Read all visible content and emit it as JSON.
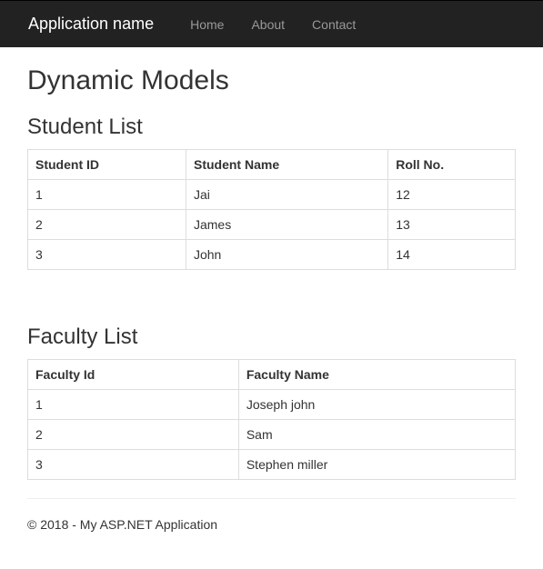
{
  "navbar": {
    "brand": "Application name",
    "links": [
      {
        "label": "Home"
      },
      {
        "label": "About"
      },
      {
        "label": "Contact"
      }
    ]
  },
  "page": {
    "title": "Dynamic Models"
  },
  "studentSection": {
    "heading": "Student List",
    "headers": {
      "id": "Student ID",
      "name": "Student Name",
      "roll": "Roll No."
    },
    "rows": [
      {
        "id": "1",
        "name": "Jai",
        "roll": "12"
      },
      {
        "id": "2",
        "name": "James",
        "roll": "13"
      },
      {
        "id": "3",
        "name": "John",
        "roll": "14"
      }
    ]
  },
  "facultySection": {
    "heading": "Faculty List",
    "headers": {
      "id": "Faculty Id",
      "name": "Faculty Name"
    },
    "rows": [
      {
        "id": "1",
        "name": "Joseph john"
      },
      {
        "id": "2",
        "name": "Sam"
      },
      {
        "id": "3",
        "name": "Stephen miller"
      }
    ]
  },
  "footer": {
    "text": "© 2018 - My ASP.NET Application"
  }
}
